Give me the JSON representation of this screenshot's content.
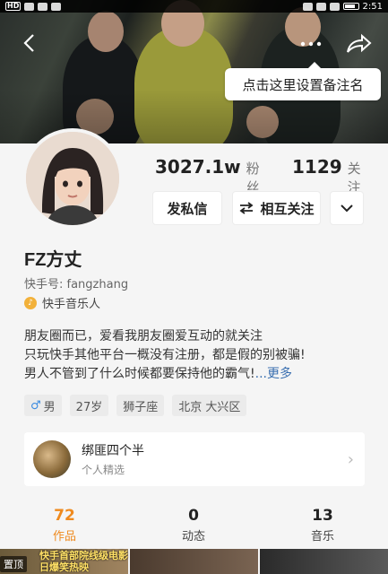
{
  "status_bar": {
    "time": "2:51"
  },
  "header": {
    "tooltip": "点击这里设置备注名"
  },
  "stats": {
    "fans_count": "3027.1w",
    "fans_label": "粉丝",
    "following_count": "1129",
    "following_label": "关注"
  },
  "actions": {
    "message": "发私信",
    "mutual_follow": "相互关注"
  },
  "profile": {
    "name": "FZ方丈",
    "kuaishou_id": "快手号: fangzhang",
    "badge": "快手音乐人",
    "bio_lines": [
      "朋友圈而已，爱看我朋友圈爱互动的就关注",
      "只玩快手其他平台一概没有注册，都是假的别被骗!",
      "男人不管到了什么时候都要保持他的霸气!"
    ],
    "bio_more": "...更多",
    "tags": [
      "男",
      "27岁",
      "狮子座",
      "北京 大兴区"
    ]
  },
  "collection": {
    "title": "绑匪四个半",
    "subtitle": "个人精选"
  },
  "tabs": [
    {
      "count": "72",
      "label": "作品"
    },
    {
      "count": "0",
      "label": "动态"
    },
    {
      "count": "13",
      "label": "音乐"
    }
  ],
  "works_strip": {
    "pinned_label": "置顶",
    "caption_line1": "快手首部院线级电影",
    "caption_line2": "日爆笑热映"
  },
  "colors": {
    "accent": "#ef8a1e",
    "link": "#3a6fb0",
    "badge": "#f2b13a"
  }
}
